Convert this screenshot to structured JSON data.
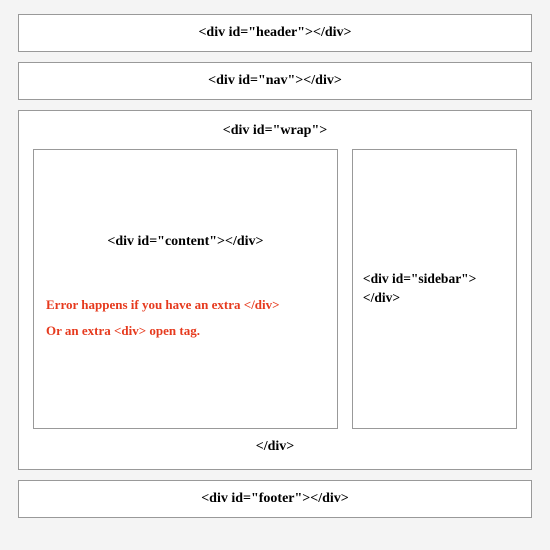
{
  "header": {
    "label": "<div id=\"header\"></div>"
  },
  "nav": {
    "label": "<div id=\"nav\"></div>"
  },
  "wrap": {
    "open_label": "<div id=\"wrap\">",
    "close_label": "</div>",
    "content": {
      "label": "<div id=\"content\"></div>",
      "error_line1": "Error happens if you have an extra </div>",
      "error_line2": "Or an extra <div> open tag."
    },
    "sidebar": {
      "label_line1": "<div id=\"sidebar\">",
      "label_line2": "</div>"
    }
  },
  "footer": {
    "label": "<div id=\"footer\"></div>"
  }
}
